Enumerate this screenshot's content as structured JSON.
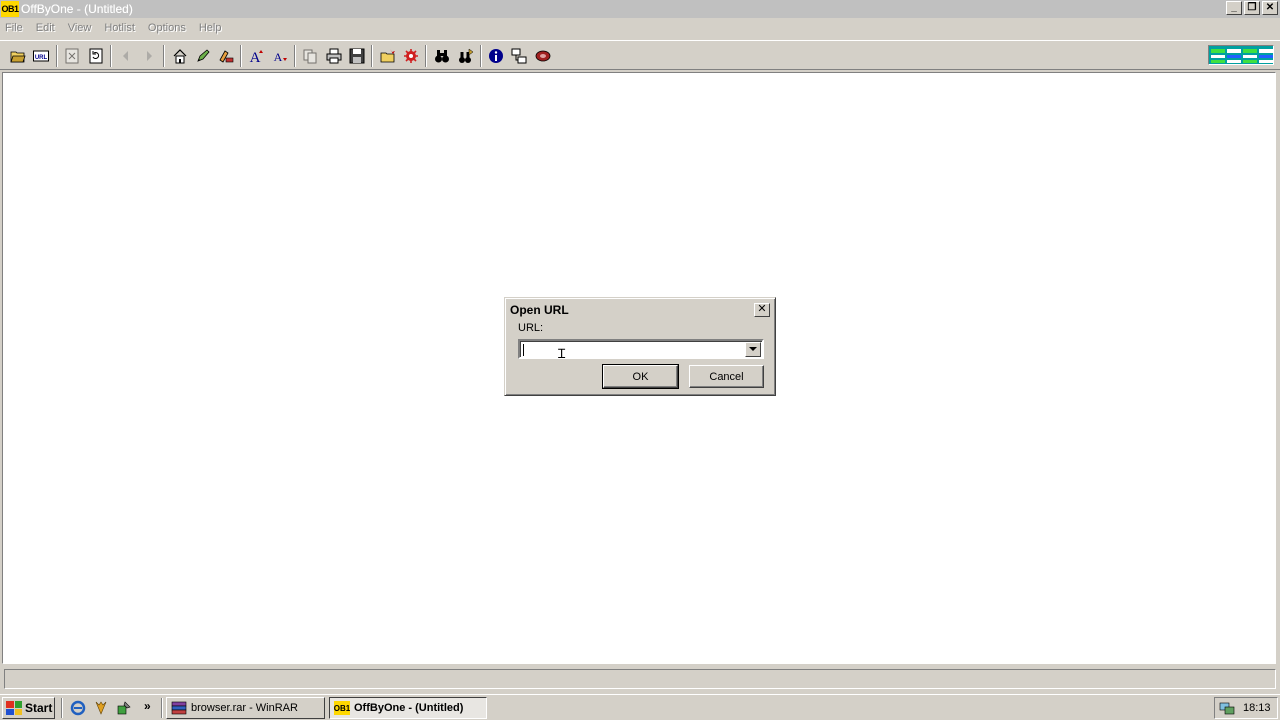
{
  "window": {
    "app_icon_text": "OB1",
    "title": "OffByOne - (Untitled)",
    "controls": [
      "_",
      "❐",
      "✕"
    ]
  },
  "menu": [
    "File",
    "Edit",
    "View",
    "Hotlist",
    "Options",
    "Help"
  ],
  "toolbar": {
    "buttons": [
      "open-file",
      "open-url",
      "stop",
      "reload",
      "back",
      "forward",
      "home",
      "edit",
      "bookmark",
      "font-larger",
      "font-smaller",
      "copy",
      "print",
      "save",
      "load-images",
      "options",
      "find",
      "find-next",
      "info",
      "view-source",
      "exit"
    ]
  },
  "dialog": {
    "title": "Open URL",
    "close_label": "✕",
    "url_label": "URL:",
    "url_value": "",
    "ok_label": "OK",
    "cancel_label": "Cancel"
  },
  "taskbar": {
    "start_label": "Start",
    "more_label": "»",
    "tasks": [
      {
        "label": "browser.rar - WinRAR",
        "active": false
      },
      {
        "label": "OffByOne - (Untitled)",
        "icon_text": "OB1",
        "active": true
      }
    ],
    "clock": "18:13"
  }
}
